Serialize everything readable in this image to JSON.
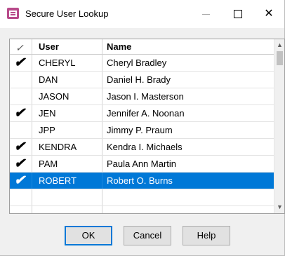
{
  "window": {
    "title": "Secure User Lookup",
    "icon": "app-icon",
    "controls": {
      "minimize": "—",
      "maximize": "☐",
      "close": "✕"
    }
  },
  "table": {
    "headers": {
      "check": "✓",
      "user": "User",
      "name": "Name"
    },
    "rows": [
      {
        "checked": "✔",
        "user": "CHERYL",
        "name": "Cheryl Bradley"
      },
      {
        "checked": "",
        "user": "DAN",
        "name": "Daniel H. Brady"
      },
      {
        "checked": "",
        "user": "JASON",
        "name": "Jason I. Masterson"
      },
      {
        "checked": "✔",
        "user": "JEN",
        "name": "Jennifer A. Noonan"
      },
      {
        "checked": "",
        "user": "JPP",
        "name": "Jimmy P. Praum"
      },
      {
        "checked": "✔",
        "user": "KENDRA",
        "name": "Kendra I. Michaels"
      },
      {
        "checked": "✔",
        "user": "PAM",
        "name": "Paula Ann Martin"
      },
      {
        "checked": "✔",
        "user": "ROBERT",
        "name": "Robert O. Burns"
      }
    ],
    "selected_user": "ROBERT",
    "selection_color": "#0078d7"
  },
  "scrollbar": {
    "up": "▲",
    "down": "▼"
  },
  "buttons": {
    "ok": "OK",
    "cancel": "Cancel",
    "help": "Help"
  }
}
